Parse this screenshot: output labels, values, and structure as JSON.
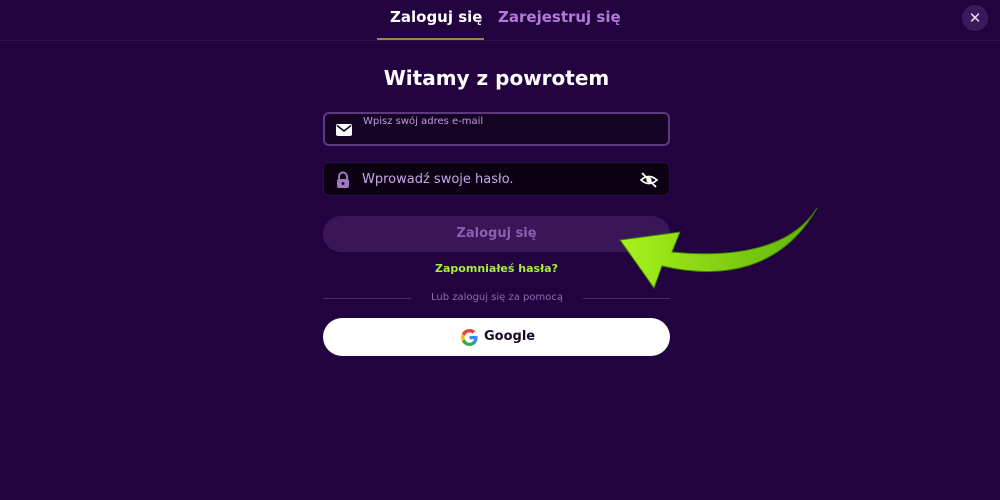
{
  "tabs": {
    "login": "Zaloguj się",
    "register": "Zarejestruj się"
  },
  "close": {
    "label": "✕"
  },
  "title": "Witamy z powrotem",
  "email": {
    "label": "Wpisz swój adres e-mail",
    "value": "",
    "icon": "mail-icon"
  },
  "password": {
    "placeholder": "Wprowadź swoje hasło.",
    "icon": "lock-icon",
    "toggle_icon": "eye-off-icon"
  },
  "login_button": "Zaloguj się",
  "forgot": "Zapomniałeś hasła?",
  "divider_text": "Lub zaloguj się za pomocą",
  "google": {
    "label": "Google",
    "icon": "google-icon"
  },
  "colors": {
    "background": "#22033f",
    "accent_green": "#a6ef3c",
    "button_disabled": "#3a1658",
    "tab_inactive": "#b47ad9"
  },
  "annotation": {
    "type": "arrow",
    "color": "#7ad610"
  }
}
